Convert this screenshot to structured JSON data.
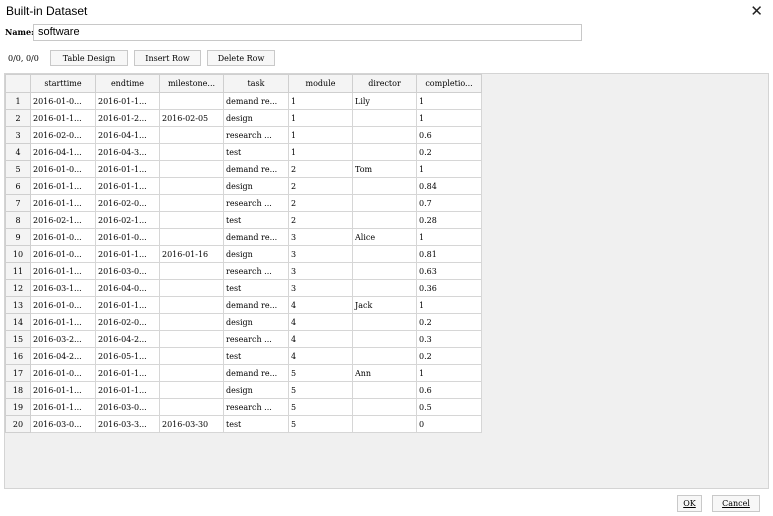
{
  "window": {
    "title": "Built-in Dataset",
    "close_glyph": "✕"
  },
  "name_field": {
    "label": "Name:",
    "value": "software"
  },
  "toolbar": {
    "counter": "0/0, 0/0",
    "table_design": "Table Design",
    "insert_row": "Insert Row",
    "delete_row": "Delete Row"
  },
  "columns": [
    "starttime",
    "endtime",
    "milestone...",
    "task",
    "module",
    "director",
    "completio..."
  ],
  "rows": [
    {
      "n": "1",
      "starttime": "2016-01-0...",
      "endtime": "2016-01-1...",
      "milestone": "",
      "task": "demand re...",
      "module": "1",
      "director": "Lily",
      "completion": "1"
    },
    {
      "n": "2",
      "starttime": "2016-01-1...",
      "endtime": "2016-01-2...",
      "milestone": "2016-02-05",
      "task": "design",
      "module": "1",
      "director": "",
      "completion": "1"
    },
    {
      "n": "3",
      "starttime": "2016-02-0...",
      "endtime": "2016-04-1...",
      "milestone": "",
      "task": "research ...",
      "module": "1",
      "director": "",
      "completion": "0.6"
    },
    {
      "n": "4",
      "starttime": "2016-04-1...",
      "endtime": "2016-04-3...",
      "milestone": "",
      "task": "test",
      "module": "1",
      "director": "",
      "completion": "0.2"
    },
    {
      "n": "5",
      "starttime": "2016-01-0...",
      "endtime": "2016-01-1...",
      "milestone": "",
      "task": "demand re...",
      "module": "2",
      "director": "Tom",
      "completion": "1"
    },
    {
      "n": "6",
      "starttime": "2016-01-1...",
      "endtime": "2016-01-1...",
      "milestone": "",
      "task": "design",
      "module": "2",
      "director": "",
      "completion": "0.84"
    },
    {
      "n": "7",
      "starttime": "2016-01-1...",
      "endtime": "2016-02-0...",
      "milestone": "",
      "task": "research ...",
      "module": "2",
      "director": "",
      "completion": "0.7"
    },
    {
      "n": "8",
      "starttime": "2016-02-1...",
      "endtime": "2016-02-1...",
      "milestone": "",
      "task": "test",
      "module": "2",
      "director": "",
      "completion": "0.28"
    },
    {
      "n": "9",
      "starttime": "2016-01-0...",
      "endtime": "2016-01-0...",
      "milestone": "",
      "task": "demand re...",
      "module": "3",
      "director": "Alice",
      "completion": "1"
    },
    {
      "n": "10",
      "starttime": "2016-01-0...",
      "endtime": "2016-01-1...",
      "milestone": "2016-01-16",
      "task": "design",
      "module": "3",
      "director": "",
      "completion": "0.81"
    },
    {
      "n": "11",
      "starttime": "2016-01-1...",
      "endtime": "2016-03-0...",
      "milestone": "",
      "task": "research ...",
      "module": "3",
      "director": "",
      "completion": "0.63"
    },
    {
      "n": "12",
      "starttime": "2016-03-1...",
      "endtime": "2016-04-0...",
      "milestone": "",
      "task": "test",
      "module": "3",
      "director": "",
      "completion": "0.36"
    },
    {
      "n": "13",
      "starttime": "2016-01-0...",
      "endtime": "2016-01-1...",
      "milestone": "",
      "task": "demand re...",
      "module": "4",
      "director": "Jack",
      "completion": "1"
    },
    {
      "n": "14",
      "starttime": "2016-01-1...",
      "endtime": "2016-02-0...",
      "milestone": "",
      "task": "design",
      "module": "4",
      "director": "",
      "completion": "0.2"
    },
    {
      "n": "15",
      "starttime": "2016-03-2...",
      "endtime": "2016-04-2...",
      "milestone": "",
      "task": "research ...",
      "module": "4",
      "director": "",
      "completion": "0.3"
    },
    {
      "n": "16",
      "starttime": "2016-04-2...",
      "endtime": "2016-05-1...",
      "milestone": "",
      "task": "test",
      "module": "4",
      "director": "",
      "completion": "0.2"
    },
    {
      "n": "17",
      "starttime": "2016-01-0...",
      "endtime": "2016-01-1...",
      "milestone": "",
      "task": "demand re...",
      "module": "5",
      "director": "Ann",
      "completion": "1"
    },
    {
      "n": "18",
      "starttime": "2016-01-1...",
      "endtime": "2016-01-1...",
      "milestone": "",
      "task": "design",
      "module": "5",
      "director": "",
      "completion": "0.6"
    },
    {
      "n": "19",
      "starttime": "2016-01-1...",
      "endtime": "2016-03-0...",
      "milestone": "",
      "task": "research ...",
      "module": "5",
      "director": "",
      "completion": "0.5"
    },
    {
      "n": "20",
      "starttime": "2016-03-0...",
      "endtime": "2016-03-3...",
      "milestone": "2016-03-30",
      "task": "test",
      "module": "5",
      "director": "",
      "completion": "0"
    }
  ],
  "footer": {
    "ok": "OK",
    "cancel": "Cancel"
  }
}
